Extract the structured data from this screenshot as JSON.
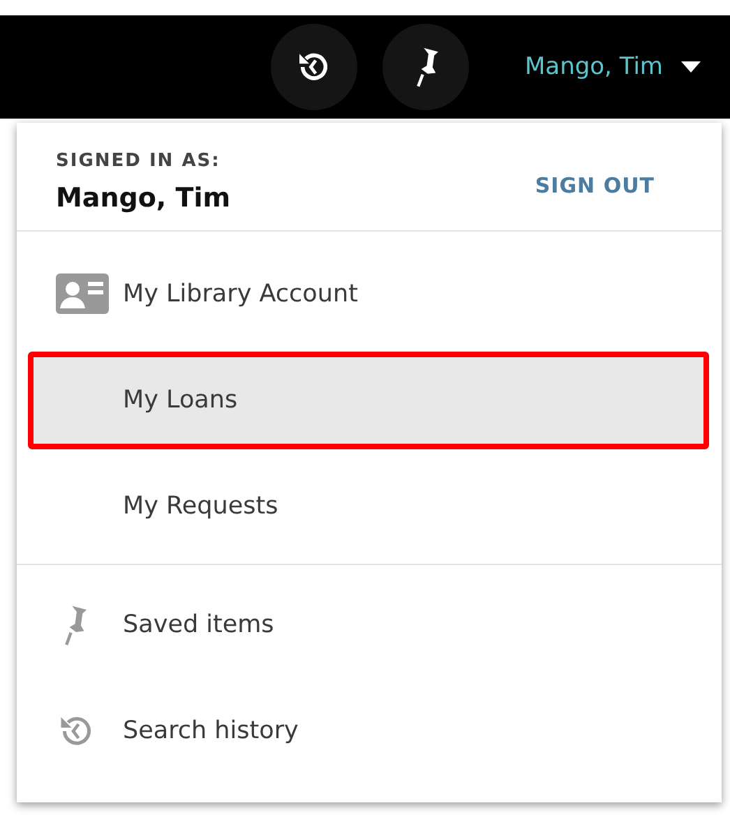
{
  "top_bar": {
    "buttons": [
      {
        "kind": "history"
      },
      {
        "kind": "pin"
      }
    ],
    "user_name": "Mango, Tim"
  },
  "menu": {
    "signed_in_label": "SIGNED IN AS:",
    "user_name": "Mango, Tim",
    "sign_out": "SIGN OUT",
    "sections": [
      {
        "items": [
          {
            "label": "My Library Account",
            "kind": "card",
            "selected": false
          },
          {
            "label": "My Loans",
            "kind": "plain",
            "selected": true
          },
          {
            "label": "My Requests",
            "kind": "plain",
            "selected": false
          }
        ]
      },
      {
        "items": [
          {
            "label": "Saved items",
            "kind": "pin",
            "selected": false
          },
          {
            "label": "Search history",
            "kind": "history",
            "selected": false
          }
        ]
      }
    ]
  }
}
